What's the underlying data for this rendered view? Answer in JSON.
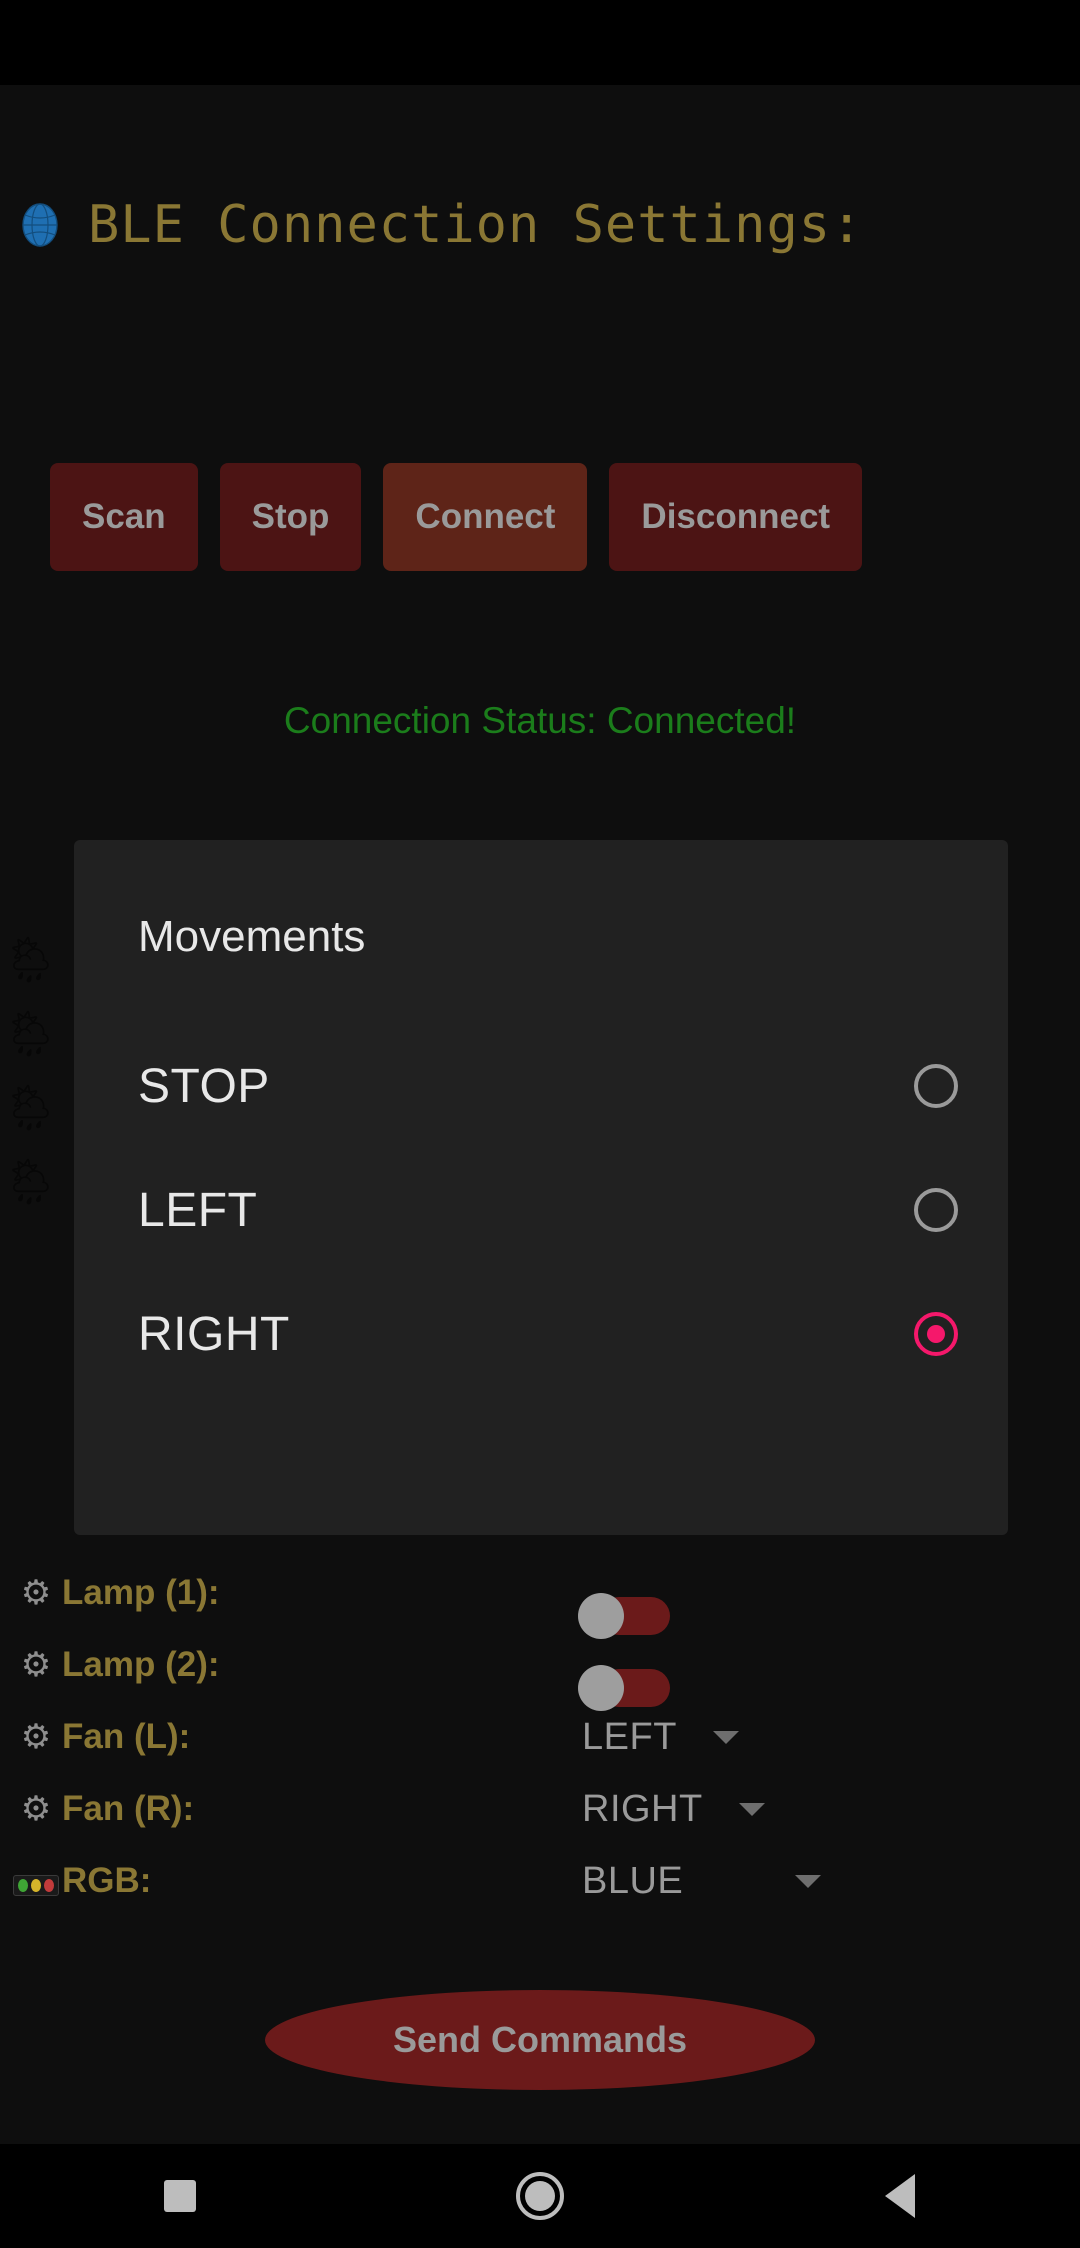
{
  "header": {
    "icon": "globe-icon",
    "title": "BLE Connection Settings:",
    "title_color": "#8a7734"
  },
  "ble_buttons": [
    {
      "label": "Scan",
      "name": "scan-button",
      "highlighted": false
    },
    {
      "label": "Stop",
      "name": "stop-button",
      "highlighted": false
    },
    {
      "label": "Connect",
      "name": "connect-button",
      "highlighted": true
    },
    {
      "label": "Disconnect",
      "name": "disconnect-button",
      "highlighted": false
    }
  ],
  "status": {
    "text": "Connection Status: Connected!",
    "color": "#1b7d1b"
  },
  "background_icons": [
    {
      "icon": "sun-behind-rain-cloud-icon",
      "glyph": "🌦"
    },
    {
      "icon": "sun-behind-rain-cloud-icon",
      "glyph": "🌦"
    },
    {
      "icon": "sun-behind-rain-cloud-icon",
      "glyph": "🌦"
    },
    {
      "icon": "sun-behind-rain-cloud-icon",
      "glyph": "🌦"
    }
  ],
  "movements_dialog": {
    "title": "Movements",
    "accent_color": "#f5186b",
    "selected": "RIGHT",
    "options": [
      {
        "label": "STOP",
        "selected": false
      },
      {
        "label": "LEFT",
        "selected": false
      },
      {
        "label": "RIGHT",
        "selected": true
      }
    ]
  },
  "settings": [
    {
      "icon": "gear-icon",
      "glyph": "⚙",
      "label": "Lamp (1):",
      "control": "toggle",
      "value": "off"
    },
    {
      "icon": "gear-icon",
      "glyph": "⚙",
      "label": "Lamp (2):",
      "control": "toggle",
      "value": "off"
    },
    {
      "icon": "gear-icon",
      "glyph": "⚙",
      "label": "Fan (L):",
      "control": "dropdown",
      "value": "LEFT"
    },
    {
      "icon": "gear-icon",
      "glyph": "⚙",
      "label": "Fan (R):",
      "control": "dropdown",
      "value": "RIGHT"
    },
    {
      "icon": "rgb-led-icon",
      "glyph": "",
      "label": "RGB:",
      "control": "dropdown",
      "value": "BLUE"
    }
  ],
  "send_commands": {
    "label": "Send Commands"
  },
  "nav_bar": {
    "recents": "recents-square-icon",
    "home": "home-circle-icon",
    "back": "back-triangle-icon"
  }
}
